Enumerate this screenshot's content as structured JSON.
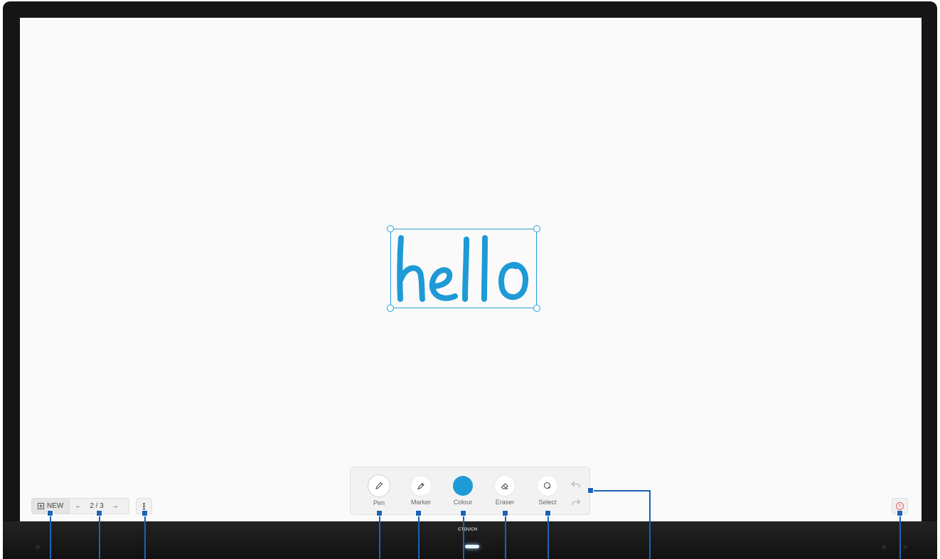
{
  "app": {
    "brand": "CTOUCH",
    "accent_color": "#1e9ad6"
  },
  "canvas": {
    "ink_text": "hello",
    "ink_color": "#1e9ad6",
    "selection_color": "#26a0da"
  },
  "page_nav": {
    "new_label": "NEW",
    "new_icon": "plus-square-icon",
    "prev_icon": "arrow-left-icon",
    "page_indicator": "2 / 3",
    "next_icon": "arrow-right-icon"
  },
  "more_menu": {
    "icon": "more-vertical-icon"
  },
  "close": {
    "icon": "close-circle-icon",
    "color": "#e4595b"
  },
  "toolbar": {
    "tools": [
      {
        "id": "pen",
        "label": "Pen",
        "icon": "pen-icon",
        "active": true
      },
      {
        "id": "marker",
        "label": "Marker",
        "icon": "marker-icon",
        "active": false
      },
      {
        "id": "colour",
        "label": "Colour",
        "icon": "colour-swatch",
        "active": false,
        "color": "#1e9ad6"
      },
      {
        "id": "eraser",
        "label": "Eraser",
        "icon": "eraser-icon",
        "active": false
      },
      {
        "id": "select",
        "label": "Select",
        "icon": "lasso-select-icon",
        "active": false
      }
    ],
    "undo_icon": "undo-icon",
    "redo_icon": "redo-icon"
  }
}
